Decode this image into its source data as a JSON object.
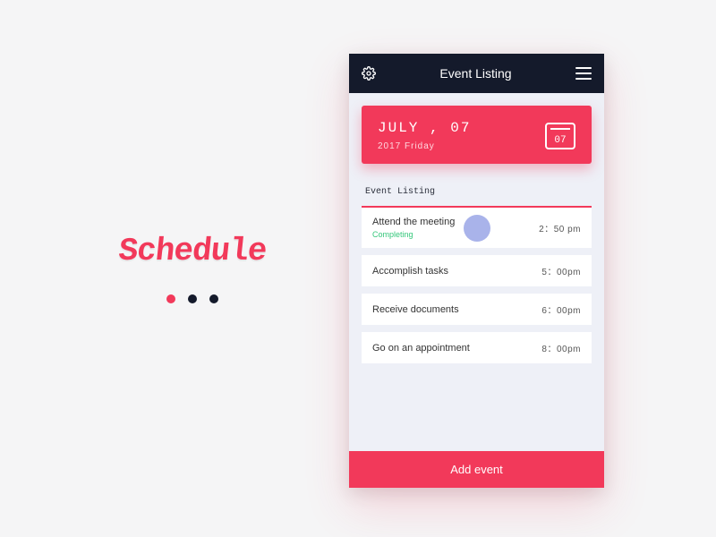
{
  "brand": {
    "logo_text": "Schedule"
  },
  "header": {
    "title": "Event Listing"
  },
  "date_card": {
    "main": "JULY  ,  07",
    "sub": "2017  Friday",
    "cal_day": "07"
  },
  "section_label": "Event Listing",
  "events": [
    {
      "title": "Attend the meeting",
      "status": "Completing",
      "time": "2：50 pm"
    },
    {
      "title": "Accomplish tasks",
      "status": "",
      "time": "5：00pm"
    },
    {
      "title": "Receive documents",
      "status": "",
      "time": "6：00pm"
    },
    {
      "title": "Go on an appointment",
      "status": "",
      "time": "8：00pm"
    }
  ],
  "add_button": "Add event",
  "colors": {
    "accent": "#f2395a",
    "dark": "#141a2b",
    "handle": "#a9b3ea",
    "success": "#35c77b"
  }
}
